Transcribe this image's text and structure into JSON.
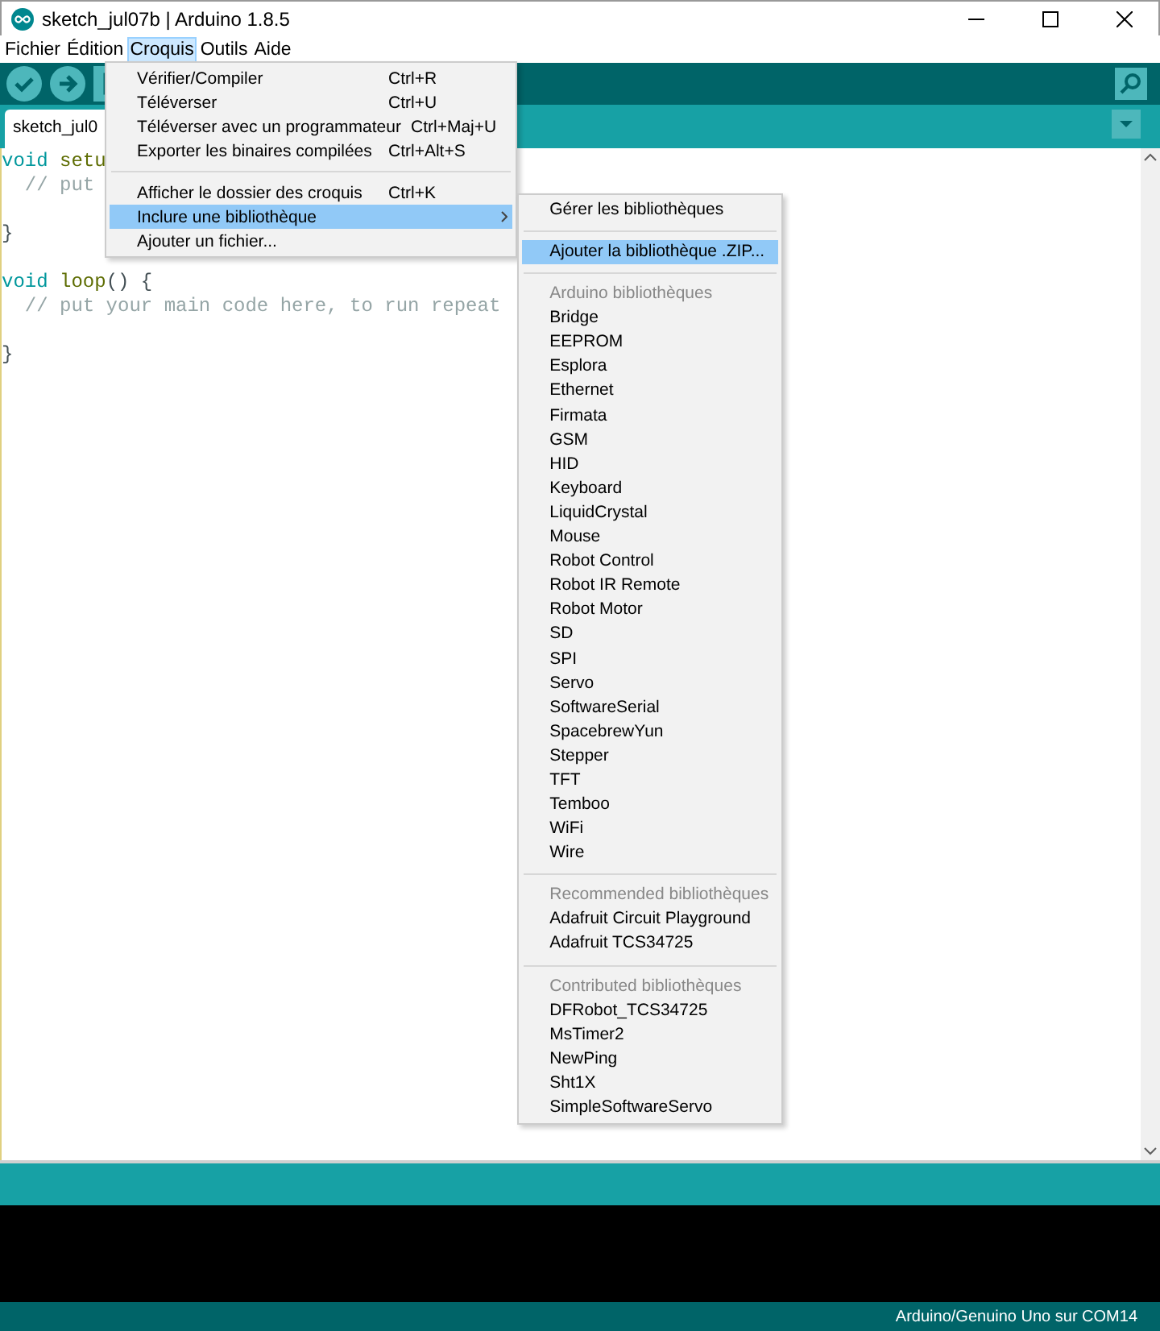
{
  "window": {
    "title": "sketch_jul07b | Arduino 1.8.5"
  },
  "menubar": [
    {
      "label": "Fichier",
      "selected": false
    },
    {
      "label": "Édition",
      "selected": false
    },
    {
      "label": "Croquis",
      "selected": true
    },
    {
      "label": "Outils",
      "selected": false
    },
    {
      "label": "Aide",
      "selected": false
    }
  ],
  "tabs": [
    {
      "label": "sketch_jul0",
      "selected": true
    }
  ],
  "editor": {
    "lines": [
      {
        "kind": "code",
        "tokens": [
          {
            "kind": "keyword",
            "text": "void "
          },
          {
            "kind": "function",
            "text": "setu"
          }
        ]
      },
      {
        "kind": "code",
        "tokens": [
          {
            "kind": "comment",
            "text": "  // put"
          }
        ]
      },
      {
        "kind": "blank"
      },
      {
        "kind": "code",
        "tokens": [
          {
            "kind": "plain",
            "text": "}"
          }
        ]
      },
      {
        "kind": "blank"
      },
      {
        "kind": "code",
        "tokens": [
          {
            "kind": "keyword",
            "text": "void "
          },
          {
            "kind": "function",
            "text": "loop"
          },
          {
            "kind": "plain",
            "text": "() {"
          }
        ]
      },
      {
        "kind": "code",
        "tokens": [
          {
            "kind": "comment",
            "text": "  // put your main code here, to run repeat"
          }
        ]
      },
      {
        "kind": "blank"
      },
      {
        "kind": "code",
        "tokens": [
          {
            "kind": "plain",
            "text": "}"
          }
        ]
      }
    ]
  },
  "menu": {
    "items": [
      {
        "kind": "item",
        "label": "Vérifier/Compiler",
        "shortcut": "Ctrl+R",
        "selected": false,
        "submenu": false
      },
      {
        "kind": "item",
        "label": "Téléverser",
        "shortcut": "Ctrl+U",
        "selected": false,
        "submenu": false
      },
      {
        "kind": "item",
        "label": "Téléverser avec un programmateur",
        "shortcut": "Ctrl+Maj+U",
        "selected": false,
        "submenu": false
      },
      {
        "kind": "item",
        "label": "Exporter les binaires compilées",
        "shortcut": "Ctrl+Alt+S",
        "selected": false,
        "submenu": false
      },
      {
        "kind": "separator"
      },
      {
        "kind": "item",
        "label": "Afficher le dossier des croquis",
        "shortcut": "Ctrl+K",
        "selected": false,
        "submenu": false
      },
      {
        "kind": "item",
        "label": "Inclure une bibliothèque",
        "selected": true,
        "submenu": true
      },
      {
        "kind": "item",
        "label": "Ajouter un fichier...",
        "selected": false,
        "submenu": false
      }
    ]
  },
  "submenu": {
    "items": [
      {
        "kind": "item",
        "label": "Gérer les bibliothèques",
        "selected": false
      },
      {
        "kind": "separator"
      },
      {
        "kind": "item",
        "label": "Ajouter la bibliothèque .ZIP...",
        "selected": true
      },
      {
        "kind": "separator"
      },
      {
        "kind": "header",
        "label": "Arduino bibliothèques"
      },
      {
        "kind": "item",
        "label": "Bridge",
        "selected": false
      },
      {
        "kind": "item",
        "label": "EEPROM",
        "selected": false
      },
      {
        "kind": "item",
        "label": "Esplora",
        "selected": false
      },
      {
        "kind": "item",
        "label": "Ethernet",
        "selected": false
      },
      {
        "kind": "item",
        "label": "Firmata",
        "selected": false
      },
      {
        "kind": "item",
        "label": "GSM",
        "selected": false
      },
      {
        "kind": "item",
        "label": "HID",
        "selected": false
      },
      {
        "kind": "item",
        "label": "Keyboard",
        "selected": false
      },
      {
        "kind": "item",
        "label": "LiquidCrystal",
        "selected": false
      },
      {
        "kind": "item",
        "label": "Mouse",
        "selected": false
      },
      {
        "kind": "item",
        "label": "Robot Control",
        "selected": false
      },
      {
        "kind": "item",
        "label": "Robot IR Remote",
        "selected": false
      },
      {
        "kind": "item",
        "label": "Robot Motor",
        "selected": false
      },
      {
        "kind": "item",
        "label": "SD",
        "selected": false
      },
      {
        "kind": "item",
        "label": "SPI",
        "selected": false
      },
      {
        "kind": "item",
        "label": "Servo",
        "selected": false
      },
      {
        "kind": "item",
        "label": "SoftwareSerial",
        "selected": false
      },
      {
        "kind": "item",
        "label": "SpacebrewYun",
        "selected": false
      },
      {
        "kind": "item",
        "label": "Stepper",
        "selected": false
      },
      {
        "kind": "item",
        "label": "TFT",
        "selected": false
      },
      {
        "kind": "item",
        "label": "Temboo",
        "selected": false
      },
      {
        "kind": "item",
        "label": "WiFi",
        "selected": false
      },
      {
        "kind": "item",
        "label": "Wire",
        "selected": false
      },
      {
        "kind": "separator"
      },
      {
        "kind": "header",
        "label": "Recommended bibliothèques"
      },
      {
        "kind": "item",
        "label": "Adafruit Circuit Playground",
        "selected": false
      },
      {
        "kind": "item",
        "label": "Adafruit TCS34725",
        "selected": false
      },
      {
        "kind": "separator"
      },
      {
        "kind": "header",
        "label": "Contributed bibliothèques"
      },
      {
        "kind": "item",
        "label": "DFRobot_TCS34725",
        "selected": false
      },
      {
        "kind": "item",
        "label": "MsTimer2",
        "selected": false
      },
      {
        "kind": "item",
        "label": "NewPing",
        "selected": false
      },
      {
        "kind": "item",
        "label": "Sht1X",
        "selected": false
      },
      {
        "kind": "item",
        "label": "SimpleSoftwareServo",
        "selected": false
      }
    ]
  },
  "status_bar": {
    "board": "Arduino/Genuino Uno sur COM14"
  }
}
